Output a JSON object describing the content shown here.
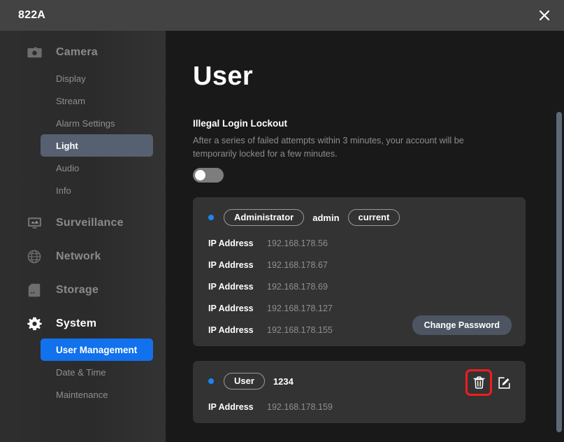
{
  "window": {
    "title": "822A",
    "close_label": "×"
  },
  "sidebar": {
    "groups": [
      {
        "label": "Camera",
        "icon": "camera-icon",
        "active": false,
        "items": [
          {
            "label": "Display",
            "state": "normal"
          },
          {
            "label": "Stream",
            "state": "normal"
          },
          {
            "label": "Alarm Settings",
            "state": "normal"
          },
          {
            "label": "Light",
            "state": "selected-gray"
          },
          {
            "label": "Audio",
            "state": "normal"
          },
          {
            "label": "Info",
            "state": "normal"
          }
        ]
      },
      {
        "label": "Surveillance",
        "icon": "monitor-icon",
        "active": false,
        "items": []
      },
      {
        "label": "Network",
        "icon": "globe-icon",
        "active": false,
        "items": []
      },
      {
        "label": "Storage",
        "icon": "sdcard-icon",
        "active": false,
        "items": []
      },
      {
        "label": "System",
        "icon": "gear-icon",
        "active": true,
        "items": [
          {
            "label": "User Management",
            "state": "selected-blue"
          },
          {
            "label": "Date & Time",
            "state": "normal"
          },
          {
            "label": "Maintenance",
            "state": "normal"
          }
        ]
      }
    ]
  },
  "main": {
    "page_title": "User",
    "lockout": {
      "title": "Illegal Login Lockout",
      "description": "After a series of failed attempts within 3 minutes, your account will be temporarily locked for a few minutes.",
      "toggle_on": false
    },
    "accounts": [
      {
        "role_badge": "Administrator",
        "username": "admin",
        "status_badge": "current",
        "online": true,
        "ip_label": "IP Address",
        "ips": [
          "192.168.178.56",
          "192.168.178.67",
          "192.168.178.69",
          "192.168.178.127",
          "192.168.178.155"
        ],
        "change_password_label": "Change Password"
      },
      {
        "role_badge": "User",
        "username": "1234",
        "online": true,
        "ip_label": "IP Address",
        "ips": [
          "192.168.178.159"
        ],
        "actions": [
          {
            "name": "delete-user-button",
            "icon": "trash-icon",
            "highlighted": true
          },
          {
            "name": "edit-user-button",
            "icon": "edit-icon",
            "highlighted": false
          }
        ]
      }
    ]
  },
  "colors": {
    "accent_blue": "#1271ec",
    "status_dot": "#1a86f0",
    "highlight_red": "#f51c1c",
    "card_bg": "#333333",
    "sidebar_bg": "#2b2b2b",
    "main_bg": "#191919",
    "titlebar_bg": "#434343"
  }
}
